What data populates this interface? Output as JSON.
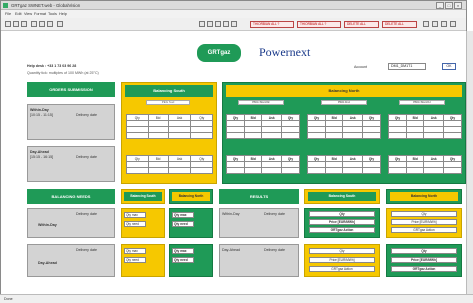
{
  "window": {
    "title": "GRTgaz SWNET.web - GlobalVision",
    "min": "_",
    "max": "□",
    "close": "×"
  },
  "menu": [
    "File",
    "Edit",
    "View",
    "Format",
    "Tools",
    "Help"
  ],
  "toolbar": {
    "red_buttons": [
      "THIORBIAN ALL ?",
      "THIORBIAN ALL ?",
      "DELETE ALL",
      "DELETE ALL"
    ]
  },
  "header": {
    "logo_grt": "GRTgaz",
    "logo_pnx": "Powernext",
    "help": "Help desk : +33 1 73 03 96 28",
    "quantity": "Quantity tick: multiples of 100 MWh (at 25°C)",
    "account_label": "Account",
    "account_value": "DM1_DM1T1",
    "ok": "OK"
  },
  "orders": {
    "title": "ORDERS SUBMISSION",
    "within_day": "Within-Day",
    "within_day_time": "[10:15 - 11:15]",
    "day_ahead": "Day-Ahead",
    "day_ahead_time": "[15:15 - 16:15]",
    "delivery_label": "Delivery date"
  },
  "south": {
    "title": "Balancing South",
    "pill": "PEG Sud"
  },
  "north": {
    "title": "Balancing North",
    "pills": [
      "PEG Nord B",
      "PEG Est",
      "PEG Nord H"
    ]
  },
  "cols": [
    "Qty",
    "Bid",
    "Ask",
    "Qty"
  ],
  "needs": {
    "title": "BALANCING NEEDS",
    "south": "Balancing South",
    "north": "Balancing North",
    "within_day": "Within-Day",
    "day_ahead": "Day-Ahead",
    "delivery_label": "Delivery date",
    "qty_max": "Qty max",
    "qty_need": "Qty need"
  },
  "results": {
    "title": "RESULTS",
    "within_day": "Within-Day",
    "day_ahead": "Day-Ahead",
    "delivery_label": "Delivery date",
    "south": "Balancing South",
    "north": "Balancing North",
    "rows": [
      "Qty",
      "Price [EUR/MWh]",
      "GRTgaz Action"
    ]
  },
  "status": "Done",
  "colors": {
    "green": "#1f9a57",
    "yellow": "#f6c800"
  }
}
